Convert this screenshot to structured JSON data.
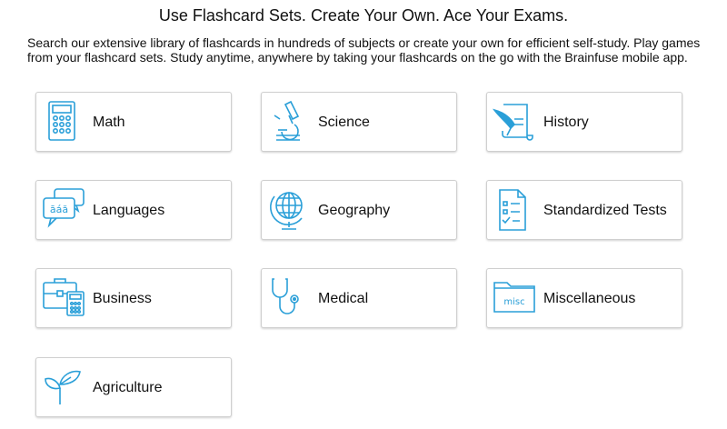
{
  "headline": "Use Flashcard Sets. Create Your Own. Ace Your Exams.",
  "intro": "Search our extensive library of flashcards in hundreds of subjects or create your own for efficient self-study. Play games from your flashcard sets. Study anytime, anywhere by taking your flashcards on the go with the Brainfuse mobile app.",
  "icon_color": "#2a9fd8",
  "subjects": [
    {
      "label": "Math",
      "icon": "calculator-icon"
    },
    {
      "label": "Science",
      "icon": "microscope-icon"
    },
    {
      "label": "History",
      "icon": "scroll-quill-icon"
    },
    {
      "label": "Languages",
      "icon": "speech-bubbles-icon",
      "icon_text": "āáă"
    },
    {
      "label": "Geography",
      "icon": "globe-icon"
    },
    {
      "label": "Standardized Tests",
      "icon": "checklist-icon"
    },
    {
      "label": "Business",
      "icon": "briefcase-calculator-icon"
    },
    {
      "label": "Medical",
      "icon": "stethoscope-icon"
    },
    {
      "label": "Miscellaneous",
      "icon": "folder-icon",
      "icon_text": "misc"
    },
    {
      "label": "Agriculture",
      "icon": "sprout-icon"
    }
  ]
}
